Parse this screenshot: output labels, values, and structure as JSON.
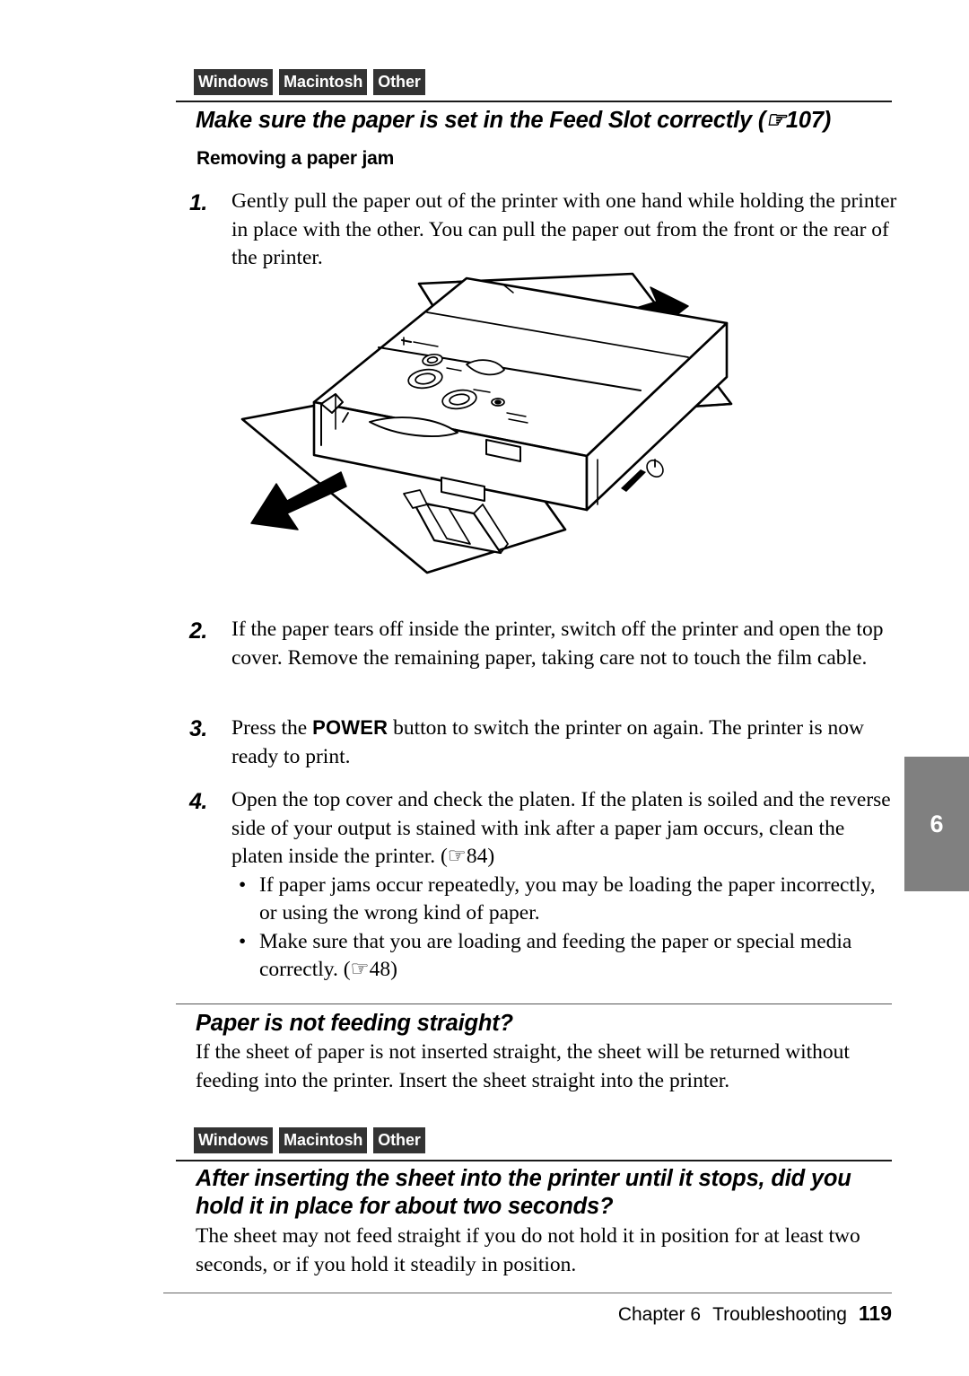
{
  "os_tags_top": [
    "Windows",
    "Macintosh",
    "Other"
  ],
  "os_tags_bottom": [
    "Windows",
    "Macintosh",
    "Other"
  ],
  "section1": {
    "heading": "Make sure the paper is set in the  Feed Slot correctly (☞107)",
    "subheading": "Removing a paper jam",
    "steps": [
      {
        "number": "1.",
        "text": "Gently pull the paper out of the printer with one hand while holding the printer in place with the other. You can pull the paper out from the front or the rear of the printer."
      },
      {
        "number": "2.",
        "text": "If the paper tears off inside the printer, switch off the printer and open the top cover. Remove the remaining paper, taking care not to touch the film cable."
      },
      {
        "number": "3.",
        "text_before_kbd": "Press the ",
        "kbd": "POWER",
        "text_after_kbd": " button to switch the printer on again. The printer is now ready to print."
      },
      {
        "number": "4.",
        "text": "Open the top cover and check the platen. If the platen is soiled and the reverse side of your output is stained with ink after a paper jam occurs, clean the platen inside the printer. (☞84)",
        "bullets": [
          "If paper jams occur repeatedly, you may be loading the paper incorrectly, or using the wrong kind of paper.",
          "Make sure that you are loading and feeding the paper or special media correctly. (☞48)"
        ]
      }
    ]
  },
  "section2": {
    "heading": "Paper is not feeding straight?",
    "body": "If the sheet of paper is not inserted straight, the sheet will be returned without feeding into the printer. Insert the sheet straight into the printer."
  },
  "section3": {
    "heading": "After inserting the sheet into the printer until it stops, did you hold it in place for about two seconds?",
    "body": "The sheet may not feed straight if you do not hold it in position for at least two seconds, or if you hold it steadily in position."
  },
  "chapter_tab": "6",
  "footer": {
    "chapter": "Chapter 6",
    "title": "Troubleshooting",
    "page": "119"
  },
  "figure": {
    "caption_semantic": "printer-paper-jam-illustration",
    "arrows": [
      "rear-pull-arrow",
      "front-pull-arrow"
    ]
  },
  "colors": {
    "badge_bg": "#333333",
    "tab_bg": "#808080",
    "rule": "#1a1a1a"
  }
}
